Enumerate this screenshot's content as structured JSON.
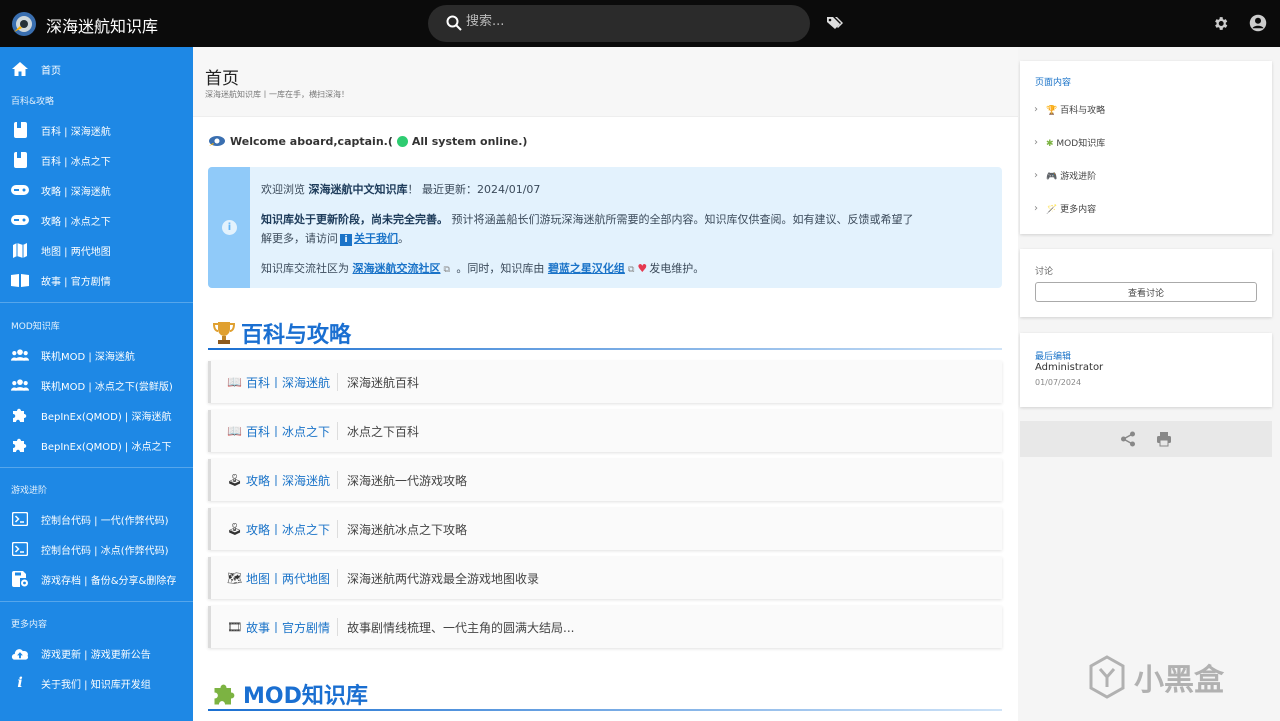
{
  "header": {
    "site_title": "深海迷航知识库",
    "search_placeholder": "搜索..."
  },
  "sidebar": {
    "home": "首页",
    "sections": [
      {
        "title": "百科&攻略",
        "items": [
          "百科 | 深海迷航",
          "百科 | 冰点之下",
          "攻略 | 深海迷航",
          "攻略 | 冰点之下",
          "地图 | 两代地图",
          "故事 | 官方剧情"
        ]
      },
      {
        "title": "MOD知识库",
        "items": [
          "联机MOD | 深海迷航",
          "联机MOD | 冰点之下(尝鲜版)",
          "BepInEx(QMOD) | 深海迷航",
          "BepInEx(QMOD) | 冰点之下"
        ]
      },
      {
        "title": "游戏进阶",
        "items": [
          "控制台代码 | 一代(作弊代码)",
          "控制台代码 | 冰点(作弊代码)",
          "游戏存档 | 备份&分享&删除存"
        ]
      },
      {
        "title": "更多内容",
        "items": [
          "游戏更新 | 游戏更新公告",
          "关于我们 | 知识库开发组"
        ]
      }
    ]
  },
  "main": {
    "page_title": "首页",
    "page_subtitle": "深海迷航知识库丨一库在手，横扫深海！",
    "welcome_pre": "Welcome aboard,captain.(",
    "welcome_post": "All system online.)",
    "info": {
      "line1_pre": "欢迎浏览 ",
      "line1_bold": "深海迷航中文知识库",
      "line1_post": "！ 最近更新：2024/01/07",
      "line2_bold": "知识库处于更新阶段，尚未完全完善。",
      "line2_rest": " 预计将涵盖船长们游玩深海迷航所需要的全部内容。知识库仅供查阅。如有建议、反馈或希望了",
      "line3_pre": "解更多，请访问",
      "line3_link": "关于我们",
      "line3_post": "。",
      "line4_pre": "知识库交流社区为 ",
      "line4_link1": "深海迷航交流社区",
      "line4_mid": " 。同时，知识库由 ",
      "line4_link2": "碧蓝之星汉化组",
      "line4_post": "发电维护。"
    },
    "section1_title": "百科与攻略",
    "cards": [
      {
        "icon": "📖",
        "title": "百科丨深海迷航",
        "desc": "深海迷航百科"
      },
      {
        "icon": "📖",
        "title": "百科丨冰点之下",
        "desc": "冰点之下百科"
      },
      {
        "icon": "🕹",
        "title": "攻略丨深海迷航",
        "desc": "深海迷航一代游戏攻略"
      },
      {
        "icon": "🕹",
        "title": "攻略丨冰点之下",
        "desc": "深海迷航冰点之下攻略"
      },
      {
        "icon": "🗺",
        "title": "地图丨两代地图",
        "desc": "深海迷航两代游戏最全游戏地图收录"
      },
      {
        "icon": "🎞",
        "title": "故事丨官方剧情",
        "desc": "故事剧情线梳理、一代主角的圆满大结局..."
      }
    ],
    "section2_title": "MOD知识库"
  },
  "toc": {
    "heading": "页面内容",
    "items": [
      "百科与攻略",
      "MOD知识库",
      "游戏进阶",
      "更多内容"
    ]
  },
  "discuss": {
    "label": "讨论",
    "button": "查看讨论"
  },
  "last_edit": {
    "label": "最后编辑",
    "user": "Administrator",
    "date": "01/07/2024"
  },
  "watermark": {
    "text": "小黑盒"
  },
  "colors": {
    "sidebar": "#1e88e5",
    "accent": "#1a6fd1",
    "info_bg": "#e3f2fd",
    "topbar": "#0b0b0b"
  }
}
